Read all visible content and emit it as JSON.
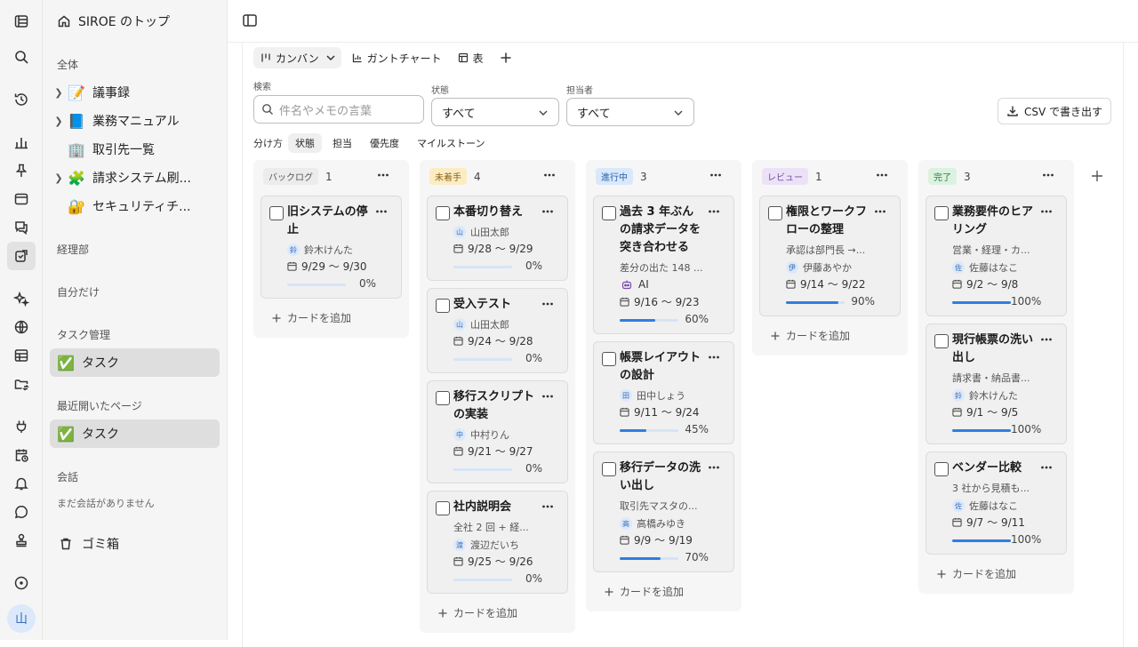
{
  "rail": {
    "avatar": "山"
  },
  "sidebar": {
    "home": "SIROE のトップ",
    "sections": {
      "all": "全体",
      "accounting": "経理部",
      "private": "自分だけ",
      "task_mgmt": "タスク管理",
      "recent": "最近開いたページ",
      "chat": "会話"
    },
    "pages": [
      {
        "icon": "📝",
        "label": "議事録"
      },
      {
        "icon": "📘",
        "label": "業務マニュアル"
      },
      {
        "icon": "🏢",
        "label": "取引先一覧"
      },
      {
        "icon": "🧩",
        "label": "請求システム刷..."
      },
      {
        "icon": "🔐",
        "label": "セキュリティチ..."
      }
    ],
    "task_item": {
      "icon": "✅",
      "label": "タスク"
    },
    "recent_item": {
      "icon": "✅",
      "label": "タスク"
    },
    "chat_empty": "まだ会話がありません",
    "trash": "ゴミ箱"
  },
  "views": {
    "kanban": "カンバン",
    "gantt": "ガントチャート",
    "table": "表"
  },
  "filters": {
    "search_label": "検索",
    "search_placeholder": "件名やメモの言葉",
    "status_label": "状態",
    "status_value": "すべて",
    "assignee_label": "担当者",
    "assignee_value": "すべて"
  },
  "csv_button": "CSV で書き出す",
  "group_by": {
    "label": "分け方",
    "options": [
      "状態",
      "担当",
      "優先度",
      "マイルストーン"
    ],
    "selected": "状態"
  },
  "add_card": "カードを追加",
  "columns": [
    {
      "name": "バックログ",
      "count": "1",
      "pill_bg": "#ececec",
      "pill_fg": "#555555",
      "cards": [
        {
          "title": "旧システムの停止",
          "memo": "",
          "assignee_initial": "鈴",
          "assignee": "鈴木けんた",
          "dates": "9/29 〜 9/30",
          "progress": 0,
          "progress_label": "0%"
        }
      ]
    },
    {
      "name": "未着手",
      "count": "4",
      "pill_bg": "#fbecc4",
      "pill_fg": "#8a6412",
      "cards": [
        {
          "title": "本番切り替え",
          "memo": "",
          "assignee_initial": "山",
          "assignee": "山田太郎",
          "dates": "9/28 〜 9/29",
          "progress": 0,
          "progress_label": "0%"
        },
        {
          "title": "受入テスト",
          "memo": "",
          "assignee_initial": "山",
          "assignee": "山田太郎",
          "dates": "9/24 〜 9/28",
          "progress": 0,
          "progress_label": "0%"
        },
        {
          "title": "移行スクリプトの実装",
          "memo": "",
          "assignee_initial": "中",
          "assignee": "中村りん",
          "dates": "9/21 〜 9/27",
          "progress": 0,
          "progress_label": "0%"
        },
        {
          "title": "社内説明会",
          "memo": "全社 2 回 + 経...",
          "assignee_initial": "渡",
          "assignee": "渡辺だいち",
          "dates": "9/25 〜 9/26",
          "progress": 0,
          "progress_label": "0%"
        }
      ]
    },
    {
      "name": "進行中",
      "count": "3",
      "pill_bg": "#d9e8fb",
      "pill_fg": "#2b62a8",
      "cards": [
        {
          "title": "過去 3 年ぶんの請求データを突き合わせる",
          "memo": "差分の出た 148 ...",
          "assignee_initial": "AI",
          "assignee": "AI",
          "ai": true,
          "dates": "9/16 〜 9/23",
          "progress": 60,
          "progress_label": "60%"
        },
        {
          "title": "帳票レイアウトの設計",
          "memo": "",
          "assignee_initial": "田",
          "assignee": "田中しょう",
          "dates": "9/11 〜 9/24",
          "progress": 45,
          "progress_label": "45%"
        },
        {
          "title": "移行データの洗い出し",
          "memo": "取引先マスタの...",
          "assignee_initial": "高",
          "assignee": "高橋みゆき",
          "dates": "9/9 〜 9/19",
          "progress": 70,
          "progress_label": "70%"
        }
      ]
    },
    {
      "name": "レビュー",
      "count": "1",
      "pill_bg": "#ece2f7",
      "pill_fg": "#7a4aa8",
      "cards": [
        {
          "title": "権限とワークフローの整理",
          "memo": "承認は部門長 →...",
          "assignee_initial": "伊",
          "assignee": "伊藤あやか",
          "dates": "9/14 〜 9/22",
          "progress": 90,
          "progress_label": "90%"
        }
      ]
    },
    {
      "name": "完了",
      "count": "3",
      "pill_bg": "#dcf2e0",
      "pill_fg": "#2e7a43",
      "cards": [
        {
          "title": "業務要件のヒアリング",
          "memo": "営業・経理・カ...",
          "assignee_initial": "佐",
          "assignee": "佐藤はなこ",
          "dates": "9/2 〜 9/8",
          "progress": 100,
          "progress_label": "100%"
        },
        {
          "title": "現行帳票の洗い出し",
          "memo": "請求書・納品書...",
          "assignee_initial": "鈴",
          "assignee": "鈴木けんた",
          "dates": "9/1 〜 9/5",
          "progress": 100,
          "progress_label": "100%"
        },
        {
          "title": "ベンダー比較",
          "memo": "3 社から見積も...",
          "assignee_initial": "佐",
          "assignee": "佐藤はなこ",
          "dates": "9/7 〜 9/11",
          "progress": 100,
          "progress_label": "100%"
        }
      ]
    }
  ]
}
